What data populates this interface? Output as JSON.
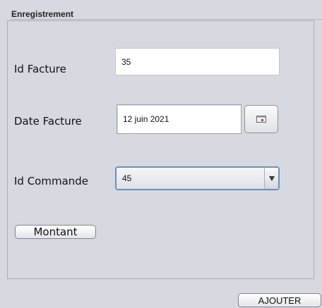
{
  "panel": {
    "title": "Enregistrement"
  },
  "form": {
    "id_facture": {
      "label": "Id Facture",
      "value": "35"
    },
    "date_facture": {
      "label": "Date Facture",
      "value": "12 juin 2021",
      "picker_icon": "calendar-icon"
    },
    "id_commande": {
      "label": "Id Commande",
      "selected": "45",
      "arrow_icon": "arrow-down-icon"
    },
    "montant_label": "Montant"
  },
  "actions": {
    "add_label": "AJOUTER"
  },
  "colors": {
    "background": "#d6d9df",
    "field_background": "#ffffff",
    "combo_focus_border": "#6e8fb8",
    "group_border": "#a9aeb6"
  }
}
